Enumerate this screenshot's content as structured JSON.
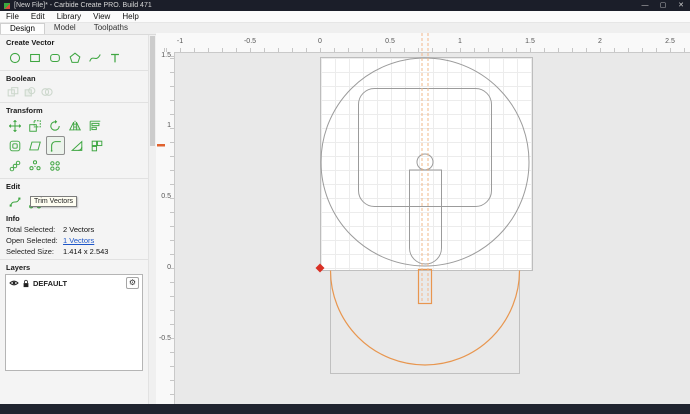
{
  "titlebar": {
    "title": "[New File]* - Carbide Create PRO. Build 471"
  },
  "menubar": {
    "items": [
      "File",
      "Edit",
      "Library",
      "View",
      "Help"
    ]
  },
  "tabs": {
    "items": [
      "Design",
      "Model",
      "Toolpaths"
    ],
    "active": "Design"
  },
  "sections": {
    "create_vector": "Create Vector",
    "boolean": "Boolean",
    "transform": "Transform",
    "edit": "Edit",
    "info": "Info",
    "layers": "Layers"
  },
  "info": {
    "rows": [
      {
        "label": "Total Selected:",
        "value": "2 Vectors"
      },
      {
        "label": "Open Selected:",
        "value": "1 Vectors"
      },
      {
        "label": "Selected Size:",
        "value": "1.414 x 2.543"
      }
    ]
  },
  "layers": {
    "name": "DEFAULT"
  },
  "tooltip": {
    "text": "Trim Vectors"
  },
  "rulers": {
    "top": [
      "-1",
      "-0.5",
      "0",
      "0.5",
      "1",
      "1.5",
      "2",
      "2.5"
    ],
    "left": [
      "1.5",
      "1",
      "0.5",
      "0",
      "-0.5"
    ]
  },
  "icons": {
    "gear": "⚙",
    "minimize": "—",
    "maximize": "▢",
    "close": "✕"
  },
  "colors": {
    "tool_green": "#3ea641",
    "vector_gray": "#9b9b9b",
    "selected_orange": "#e8964f",
    "origin_red": "#d93025",
    "link_blue": "#1d56c8"
  }
}
